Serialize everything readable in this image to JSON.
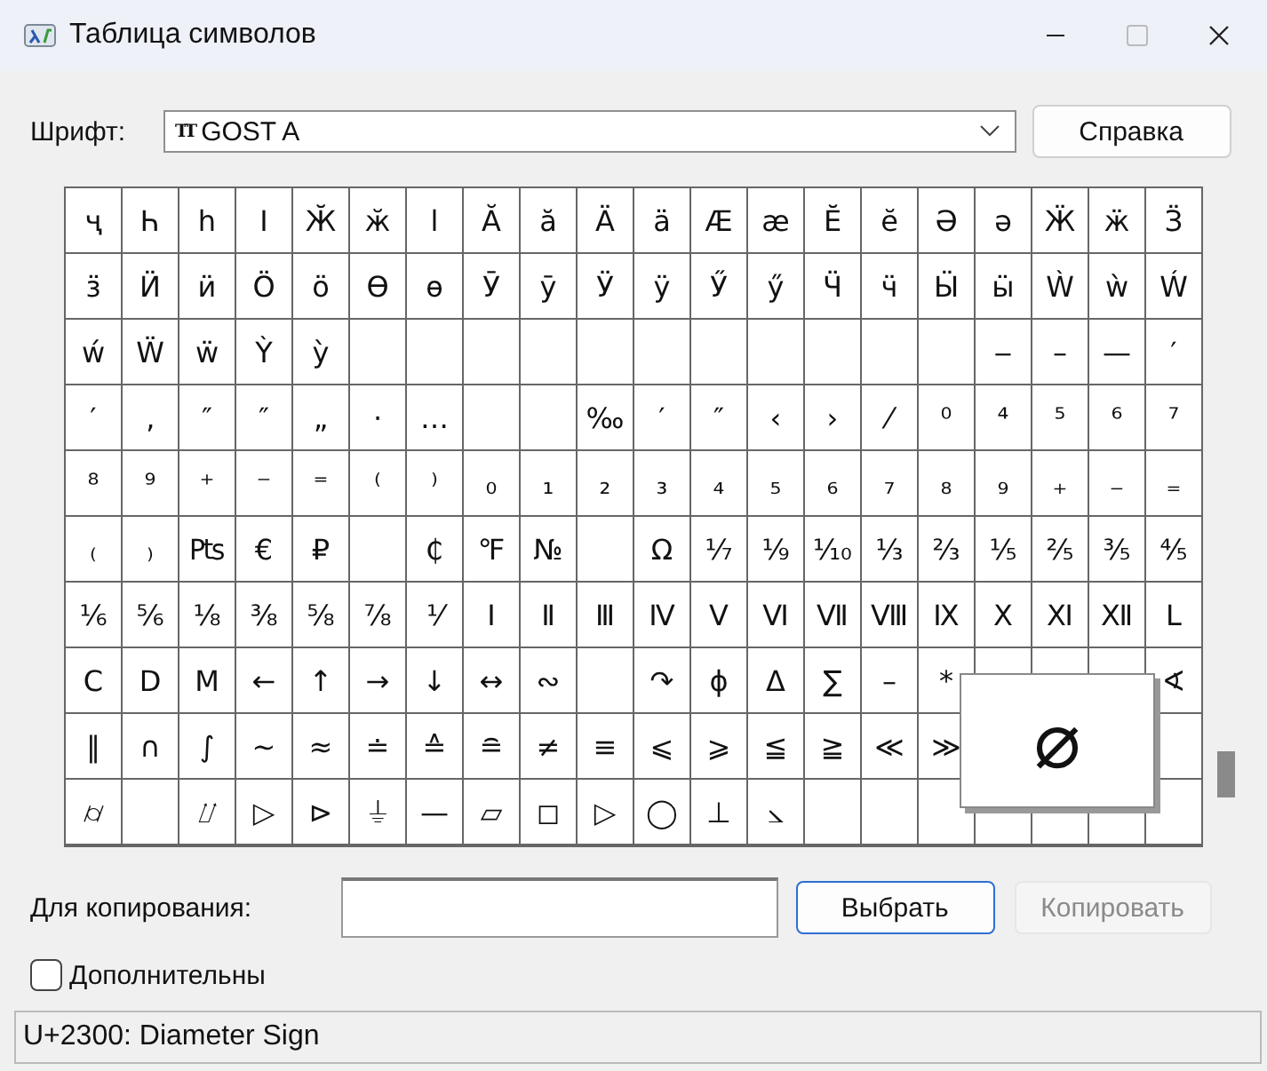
{
  "window": {
    "title": "Таблица символов"
  },
  "font": {
    "label": "Шрифт:",
    "icon_text": "TT",
    "value": "GOST A"
  },
  "help_button": "Справка",
  "grid": {
    "rows": [
      [
        "ҷ",
        "Һ",
        "һ",
        "Ӏ",
        "Ӂ",
        "ӂ",
        "ӏ",
        "Ӑ",
        "ӑ",
        "Ӓ",
        "ӓ",
        "Æ",
        "æ",
        "Ӗ",
        "ӗ",
        "Ә",
        "ә",
        "Ӝ",
        "ӝ",
        "Ӟ"
      ],
      [
        "ӟ",
        "Ӥ",
        "ӥ",
        "Ӧ",
        "ӧ",
        "Ө",
        "ө",
        "Ӯ",
        "ӯ",
        "Ӱ",
        "ӱ",
        "Ӳ",
        "ӳ",
        "Ӵ",
        "ӵ",
        "Ӹ",
        "ӹ",
        "Ẁ",
        "ẁ",
        "Ẃ"
      ],
      [
        "ẃ",
        "Ẅ",
        "ẅ",
        "Ỳ",
        "ỳ",
        null,
        null,
        null,
        null,
        null,
        null,
        null,
        null,
        null,
        null,
        null,
        "‒",
        "–",
        "—",
        "′"
      ],
      [
        "′",
        "‚",
        "″",
        "″",
        "„",
        "·",
        "…",
        null,
        null,
        "‰",
        "′",
        "″",
        "‹",
        "›",
        "⁄",
        "⁰",
        "⁴",
        "⁵",
        "⁶",
        "⁷"
      ],
      [
        "⁸",
        "⁹",
        "⁺",
        "⁻",
        "⁼",
        "⁽",
        "⁾",
        "₀",
        "₁",
        "₂",
        "₃",
        "₄",
        "₅",
        "₆",
        "₇",
        "₈",
        "₉",
        "₊",
        "₋",
        "₌"
      ],
      [
        "₍",
        "₎",
        "₧",
        "€",
        "₽",
        null,
        "₵",
        "℉",
        "№",
        null,
        "Ω",
        "⅐",
        "⅑",
        "⅒",
        "⅓",
        "⅔",
        "⅕",
        "⅖",
        "⅗",
        "⅘"
      ],
      [
        "⅙",
        "⅚",
        "⅛",
        "⅜",
        "⅝",
        "⅞",
        "⅟",
        "Ⅰ",
        "Ⅱ",
        "Ⅲ",
        "Ⅳ",
        "Ⅴ",
        "Ⅵ",
        "Ⅶ",
        "Ⅷ",
        "Ⅸ",
        "Ⅹ",
        "Ⅺ",
        "Ⅻ",
        "Ⅼ"
      ],
      [
        "Ⅽ",
        "Ⅾ",
        "Ⅿ",
        "←",
        "↑",
        "→",
        "↓",
        "↔",
        "∾",
        null,
        "↷",
        "ϕ",
        "Δ",
        "∑",
        "–",
        "*",
        null,
        null,
        null,
        "∢"
      ],
      [
        "‖",
        "∩",
        "∫",
        "~",
        "≈",
        "≐",
        "≙",
        "≘",
        "≠",
        "≡",
        "⩽",
        "⩾",
        "≦",
        "≧",
        "≪",
        "≫",
        null,
        null,
        null,
        null
      ],
      [
        "⌭",
        null,
        "⌰",
        "▷",
        "⊳",
        "⏚",
        "—",
        "⏥",
        "◻",
        "▷",
        "◯",
        "⊥",
        "⦣",
        null,
        null,
        null,
        null,
        null,
        null,
        null
      ]
    ]
  },
  "preview": {
    "glyph": "⌀"
  },
  "copy": {
    "label": "Для копирования:",
    "select_button": "Выбрать",
    "copy_button": {
      "label": "Копировать",
      "disabled": true
    }
  },
  "advanced": {
    "label": "Дополнительны",
    "checked": false
  },
  "status_bar": "U+2300: Diameter Sign"
}
